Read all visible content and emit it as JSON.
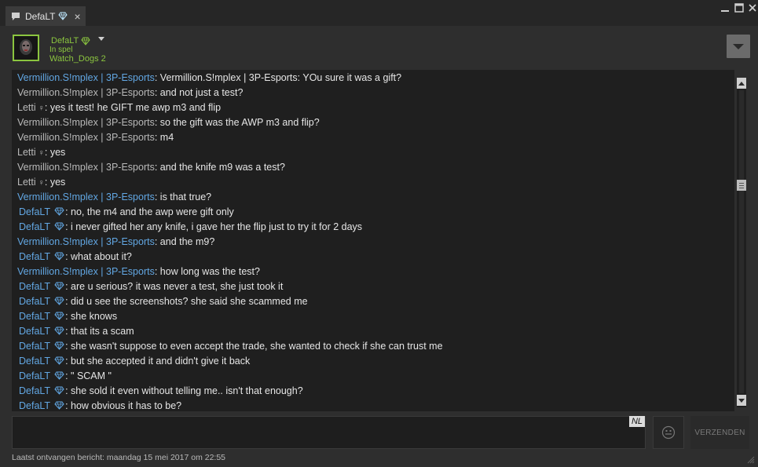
{
  "colors": {
    "accent_green": "#8bc53f",
    "sender_blue": "#62a7e3",
    "text_white": "#e6e6e6",
    "text_gray": "#b9b9b9"
  },
  "tab": {
    "title": "DefaLT",
    "chat_icon": "chat-bubble-icon",
    "badge_icon": "diamond-icon",
    "close_glyph": "×"
  },
  "window": {
    "minimize_icon": "minimize-icon",
    "maximize_icon": "maximize-icon",
    "close_icon": "close-icon"
  },
  "header": {
    "name": "DefaLT",
    "status": "In spel",
    "game": "Watch_Dogs 2",
    "menu_icon": "chevron-down-icon"
  },
  "messages": [
    {
      "sender": "Vermillion.S!mplex | 3P-Esports",
      "style": "blue",
      "text": "Vermillion.S!mplex | 3P-Esports: YOu sure it was a gift?"
    },
    {
      "sender": "Vermillion.S!mplex | 3P-Esports",
      "style": "gray",
      "text": "and not just a test?"
    },
    {
      "sender": "Letti",
      "style": "female",
      "text": "yes it test! he GIFT me awp m3 and flip"
    },
    {
      "sender": "Vermillion.S!mplex | 3P-Esports",
      "style": "gray",
      "text": "so the gift was the AWP m3 and flip?"
    },
    {
      "sender": "Vermillion.S!mplex | 3P-Esports",
      "style": "gray",
      "text": "m4"
    },
    {
      "sender": "Letti",
      "style": "female",
      "text": "yes"
    },
    {
      "sender": "Vermillion.S!mplex | 3P-Esports",
      "style": "gray",
      "text": "and the knife m9 was a test?"
    },
    {
      "sender": "Letti",
      "style": "female",
      "text": "yes"
    },
    {
      "sender": "Vermillion.S!mplex | 3P-Esports",
      "style": "blue",
      "text": "is that true?"
    },
    {
      "sender": "DefaLT",
      "style": "defalt",
      "text": "no, the m4 and the awp were gift only"
    },
    {
      "sender": "DefaLT",
      "style": "defalt",
      "text": "i never gifted her any knife, i gave her the flip just to try it for 2 days"
    },
    {
      "sender": "Vermillion.S!mplex | 3P-Esports",
      "style": "blue",
      "text": "and the m9?"
    },
    {
      "sender": "DefaLT",
      "style": "defalt",
      "text": "what about it?"
    },
    {
      "sender": "Vermillion.S!mplex | 3P-Esports",
      "style": "blue",
      "text": "how long was the test?"
    },
    {
      "sender": "DefaLT",
      "style": "defalt",
      "text": "are u serious? it was never a test, she just took it"
    },
    {
      "sender": "DefaLT",
      "style": "defalt",
      "text": "did u see the screenshots? she said she scammed me"
    },
    {
      "sender": "DefaLT",
      "style": "defalt",
      "text": "she knows"
    },
    {
      "sender": "DefaLT",
      "style": "defalt",
      "text": "that its a scam"
    },
    {
      "sender": "DefaLT",
      "style": "defalt",
      "text": "she wasn't suppose to even accept the trade, she wanted to check if she can trust me"
    },
    {
      "sender": "DefaLT",
      "style": "defalt",
      "text": "but she accepted it and didn't give it back"
    },
    {
      "sender": "DefaLT",
      "style": "defalt",
      "text": "\" SCAM \""
    },
    {
      "sender": "DefaLT",
      "style": "defalt",
      "text": "she sold it even without telling me.. isn't that enough?"
    },
    {
      "sender": "DefaLT",
      "style": "defalt",
      "text": "how obvious it has to be?"
    }
  ],
  "input": {
    "value": "",
    "language_badge": "NL"
  },
  "emoji_button": {
    "icon": "smiley-icon"
  },
  "send_button": {
    "label": "VERZENDEN"
  },
  "footer": {
    "last_received": "Laatst ontvangen bericht: maandag 15 mei 2017 om 22:55"
  }
}
